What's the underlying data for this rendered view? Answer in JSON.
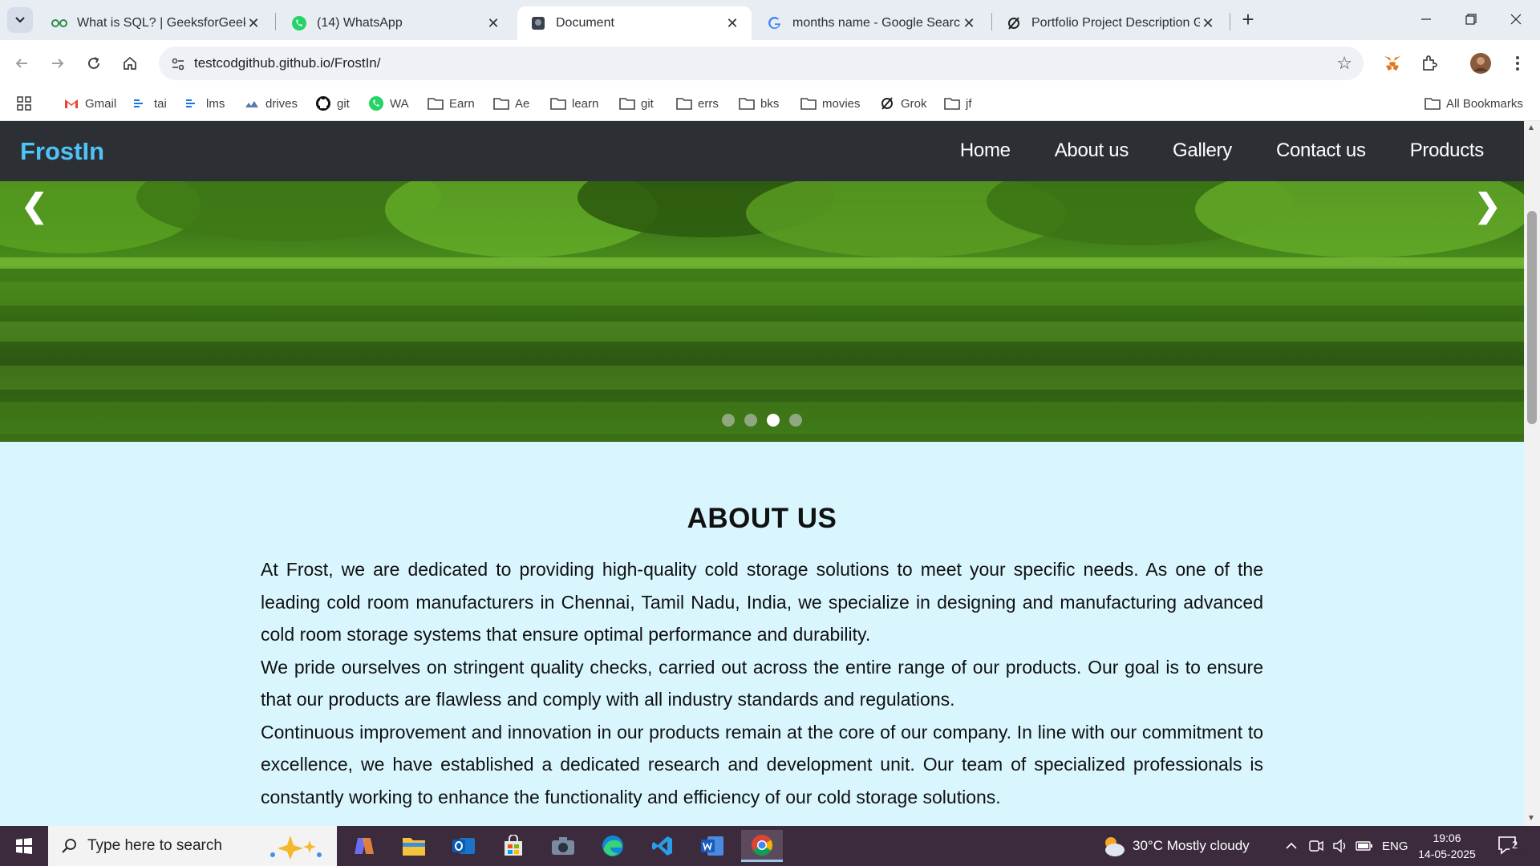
{
  "browser": {
    "tabs": [
      {
        "title": "What is SQL? | GeeksforGeeks",
        "icon": "geeksforgeeks-icon"
      },
      {
        "title": "(14) WhatsApp",
        "icon": "whatsapp-icon"
      },
      {
        "title": "Document",
        "icon": "document-icon",
        "active": true
      },
      {
        "title": "months name - Google Search",
        "icon": "google-icon"
      },
      {
        "title": "Portfolio Project Description Gu",
        "icon": "grok-icon"
      }
    ],
    "new_tab": "+",
    "url": "testcodgithub.github.io/FrostIn/",
    "bookmarks": [
      {
        "label": "Gmail",
        "icon": "gmail-icon"
      },
      {
        "label": "tai",
        "icon": "link-icon"
      },
      {
        "label": "lms",
        "icon": "link-icon"
      },
      {
        "label": "drives",
        "icon": "drive-icon"
      },
      {
        "label": "git",
        "icon": "github-icon"
      },
      {
        "label": "WA",
        "icon": "whatsapp-icon"
      },
      {
        "label": "Earn",
        "icon": "folder-icon"
      },
      {
        "label": "Ae",
        "icon": "folder-icon"
      },
      {
        "label": "learn",
        "icon": "folder-icon"
      },
      {
        "label": "git",
        "icon": "folder-icon"
      },
      {
        "label": "errs",
        "icon": "folder-icon"
      },
      {
        "label": "bks",
        "icon": "folder-icon"
      },
      {
        "label": "movies",
        "icon": "folder-icon"
      },
      {
        "label": "Grok",
        "icon": "grok-icon"
      },
      {
        "label": "jf",
        "icon": "folder-icon"
      }
    ],
    "all_bookmarks": "All Bookmarks"
  },
  "site": {
    "logo": "FrostIn",
    "nav": [
      "Home",
      "About us",
      "Gallery",
      "Contact us",
      "Products"
    ],
    "slider": {
      "prev": "❮",
      "next": "❯",
      "slide_count": 4,
      "active_index": 2
    },
    "about": {
      "heading": "ABOUT US",
      "paragraphs": [
        "At Frost, we are dedicated to providing high-quality cold storage solutions to meet your specific needs. As one of the leading cold room manufacturers in Chennai, Tamil Nadu, India, we specialize in designing and manufacturing advanced cold room storage systems that ensure optimal performance and durability.",
        "We pride ourselves on stringent quality checks, carried out across the entire range of our products. Our goal is to ensure that our products are flawless and comply with all industry standards and regulations.",
        "Continuous improvement and innovation in our products remain at the core of our company. In line with our commitment to excellence, we have established a dedicated research and development unit. Our team of specialized professionals is constantly working to enhance the functionality and efficiency of our cold storage solutions."
      ]
    }
  },
  "taskbar": {
    "search_placeholder": "Type here to search",
    "weather": "30°C  Mostly cloudy",
    "language": "ENG",
    "time": "19:06",
    "date": "14-05-2025",
    "notification_count": "2"
  },
  "colors": {
    "accent": "#4fc3f7",
    "nav_bg": "#2c3035",
    "page_bg": "#d9f6ff",
    "taskbar_bg": "#3b2b3d"
  }
}
